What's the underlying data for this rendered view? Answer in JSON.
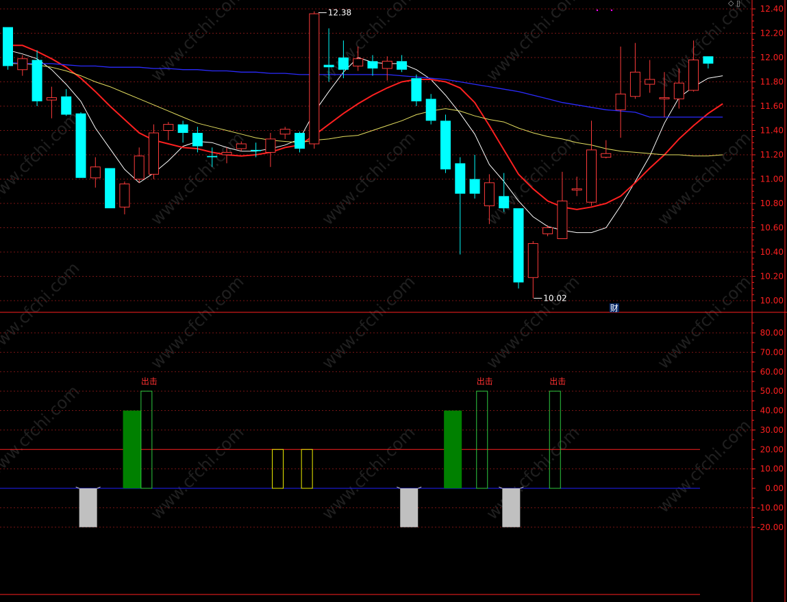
{
  "watermark": "www.cfchi.com",
  "colors": {
    "background": "#000000",
    "up": "#ff3b3b",
    "down": "#00ffff",
    "ma5": "#ffffff",
    "ma10": "#ff2020",
    "ma20": "#e6e060",
    "ma60": "#2b2bff",
    "axis": "#ff2020",
    "grid": "#7a1515",
    "green_bar": "#008000",
    "green_outline": "#2ecc40",
    "yellow_outline": "#f0f000",
    "gray_bar": "#c0c0c0",
    "signal_text": "#ff3030",
    "zero_line": "#2020ff"
  },
  "markers": {
    "high_label": "12.38",
    "low_label": "10.02",
    "cai_label": "财"
  },
  "chart_data": [
    {
      "type": "candlestick",
      "yaxis": {
        "ticks": [
          "12.40",
          "12.20",
          "12.00",
          "11.80",
          "11.60",
          "11.40",
          "11.20",
          "11.00",
          "10.80",
          "10.60",
          "10.40",
          "10.20",
          "10.00"
        ],
        "ylim": [
          9.93,
          12.46
        ]
      },
      "candles": [
        {
          "o": 12.25,
          "c": 11.93,
          "h": 12.25,
          "l": 11.9
        },
        {
          "o": 11.9,
          "c": 11.99,
          "h": 12.02,
          "l": 11.85
        },
        {
          "o": 11.98,
          "c": 11.64,
          "h": 12.06,
          "l": 11.6
        },
        {
          "o": 11.65,
          "c": 11.67,
          "h": 11.76,
          "l": 11.5
        },
        {
          "o": 11.68,
          "c": 11.53,
          "h": 11.74,
          "l": 11.52
        },
        {
          "o": 11.54,
          "c": 11.01,
          "h": 11.55,
          "l": 11.01
        },
        {
          "o": 11.01,
          "c": 11.1,
          "h": 11.18,
          "l": 10.93
        },
        {
          "o": 11.09,
          "c": 10.76,
          "h": 11.09,
          "l": 10.76
        },
        {
          "o": 10.77,
          "c": 10.96,
          "h": 10.98,
          "l": 10.71
        },
        {
          "o": 11.0,
          "c": 11.19,
          "h": 11.26,
          "l": 10.97
        },
        {
          "o": 11.04,
          "c": 11.38,
          "h": 11.45,
          "l": 11.0
        },
        {
          "o": 11.4,
          "c": 11.45,
          "h": 11.47,
          "l": 11.32
        },
        {
          "o": 11.45,
          "c": 11.38,
          "h": 11.48,
          "l": 11.3
        },
        {
          "o": 11.38,
          "c": 11.27,
          "h": 11.43,
          "l": 11.22
        },
        {
          "o": 11.19,
          "c": 11.18,
          "h": 11.26,
          "l": 11.1
        },
        {
          "o": 11.2,
          "c": 11.22,
          "h": 11.26,
          "l": 11.13
        },
        {
          "o": 11.25,
          "c": 11.29,
          "h": 11.31,
          "l": 11.23
        },
        {
          "o": 11.24,
          "c": 11.23,
          "h": 11.3,
          "l": 11.18
        },
        {
          "o": 11.22,
          "c": 11.33,
          "h": 11.38,
          "l": 11.1
        },
        {
          "o": 11.37,
          "c": 11.41,
          "h": 11.43,
          "l": 11.33
        },
        {
          "o": 11.38,
          "c": 11.25,
          "h": 11.39,
          "l": 11.22
        },
        {
          "o": 11.29,
          "c": 12.36,
          "h": 12.38,
          "l": 11.25
        },
        {
          "o": 11.94,
          "c": 11.92,
          "h": 12.24,
          "l": 11.8
        },
        {
          "o": 12.0,
          "c": 11.9,
          "h": 12.14,
          "l": 11.83
        },
        {
          "o": 11.93,
          "c": 11.99,
          "h": 12.09,
          "l": 11.89
        },
        {
          "o": 11.97,
          "c": 11.91,
          "h": 12.02,
          "l": 11.85
        },
        {
          "o": 11.91,
          "c": 11.97,
          "h": 12.01,
          "l": 11.81
        },
        {
          "o": 11.97,
          "c": 11.9,
          "h": 12.02,
          "l": 11.88
        },
        {
          "o": 11.83,
          "c": 11.64,
          "h": 11.86,
          "l": 11.6
        },
        {
          "o": 11.66,
          "c": 11.48,
          "h": 11.7,
          "l": 11.45
        },
        {
          "o": 11.48,
          "c": 11.08,
          "h": 11.53,
          "l": 11.05
        },
        {
          "o": 11.13,
          "c": 10.88,
          "h": 11.18,
          "l": 10.38
        },
        {
          "o": 11.0,
          "c": 10.88,
          "h": 11.2,
          "l": 10.84
        },
        {
          "o": 10.78,
          "c": 10.97,
          "h": 11.04,
          "l": 10.63
        },
        {
          "o": 10.86,
          "c": 10.76,
          "h": 11.05,
          "l": 10.73
        },
        {
          "o": 10.76,
          "c": 10.15,
          "h": 10.76,
          "l": 10.1
        },
        {
          "o": 10.19,
          "c": 10.47,
          "h": 10.49,
          "l": 10.02
        },
        {
          "o": 10.55,
          "c": 10.6,
          "h": 10.62,
          "l": 10.53
        },
        {
          "o": 10.51,
          "c": 10.82,
          "h": 11.06,
          "l": 10.51
        },
        {
          "o": 10.91,
          "c": 10.92,
          "h": 11.02,
          "l": 10.86
        },
        {
          "o": 10.81,
          "c": 11.24,
          "h": 11.48,
          "l": 10.78
        },
        {
          "o": 11.18,
          "c": 11.21,
          "h": 11.32,
          "l": 11.17
        },
        {
          "o": 11.57,
          "c": 11.7,
          "h": 12.09,
          "l": 11.34
        },
        {
          "o": 11.68,
          "c": 11.88,
          "h": 12.12,
          "l": 11.66
        },
        {
          "o": 11.78,
          "c": 11.82,
          "h": 11.98,
          "l": 11.71
        },
        {
          "o": 11.66,
          "c": 11.67,
          "h": 11.88,
          "l": 11.51
        },
        {
          "o": 11.66,
          "c": 11.79,
          "h": 11.91,
          "l": 11.58
        },
        {
          "o": 11.73,
          "c": 11.98,
          "h": 12.14,
          "l": 11.72
        },
        {
          "o": 12.01,
          "c": 11.95,
          "h": 12.01,
          "l": 11.91
        }
      ],
      "ma_series": [
        {
          "key": "ma5",
          "values": [
            12.06,
            12.03,
            11.99,
            11.9,
            11.78,
            11.64,
            11.42,
            11.25,
            11.08,
            10.97,
            11.05,
            11.15,
            11.27,
            11.31,
            11.3,
            11.26,
            11.23,
            11.23,
            11.25,
            11.28,
            11.33,
            11.55,
            11.72,
            11.88,
            12.0,
            11.96,
            11.95,
            11.95,
            11.9,
            11.82,
            11.69,
            11.54,
            11.37,
            11.12,
            10.98,
            10.82,
            10.69,
            10.61,
            10.58,
            10.56,
            10.56,
            10.6,
            10.78,
            10.98,
            11.19,
            11.46,
            11.67,
            11.76,
            11.83,
            11.85
          ]
        },
        {
          "key": "ma10",
          "values": [
            12.1,
            12.1,
            12.05,
            11.99,
            11.92,
            11.83,
            11.72,
            11.6,
            11.49,
            11.38,
            11.32,
            11.29,
            11.26,
            11.25,
            11.22,
            11.2,
            11.19,
            11.2,
            11.22,
            11.26,
            11.28,
            11.36,
            11.45,
            11.54,
            11.62,
            11.69,
            11.75,
            11.8,
            11.82,
            11.82,
            11.8,
            11.75,
            11.63,
            11.44,
            11.24,
            11.04,
            10.92,
            10.82,
            10.77,
            10.75,
            10.77,
            10.8,
            10.86,
            10.97,
            11.09,
            11.2,
            11.33,
            11.44,
            11.54,
            11.62
          ]
        },
        {
          "key": "ma20",
          "values": [
            11.95,
            11.95,
            11.94,
            11.92,
            11.89,
            11.85,
            11.8,
            11.76,
            11.71,
            11.66,
            11.61,
            11.56,
            11.51,
            11.46,
            11.43,
            11.4,
            11.37,
            11.34,
            11.32,
            11.31,
            11.3,
            11.32,
            11.33,
            11.35,
            11.36,
            11.4,
            11.44,
            11.48,
            11.53,
            11.56,
            11.58,
            11.56,
            11.52,
            11.49,
            11.47,
            11.42,
            11.38,
            11.35,
            11.33,
            11.3,
            11.28,
            11.25,
            11.23,
            11.22,
            11.21,
            11.2,
            11.2,
            11.19,
            11.19,
            11.2
          ]
        },
        {
          "key": "ma60",
          "values": [
            11.96,
            11.95,
            11.95,
            11.95,
            11.94,
            11.93,
            11.93,
            11.92,
            11.92,
            11.92,
            11.91,
            11.91,
            11.9,
            11.9,
            11.89,
            11.89,
            11.88,
            11.88,
            11.87,
            11.87,
            11.86,
            11.86,
            11.86,
            11.86,
            11.86,
            11.86,
            11.86,
            11.85,
            11.84,
            11.83,
            11.82,
            11.8,
            11.78,
            11.76,
            11.74,
            11.72,
            11.69,
            11.66,
            11.63,
            11.61,
            11.59,
            11.57,
            11.56,
            11.55,
            11.51,
            11.51,
            11.51,
            11.51,
            11.51,
            11.51
          ]
        }
      ]
    },
    {
      "type": "bar",
      "yaxis": {
        "ticks": [
          "80.00",
          "70.00",
          "60.00",
          "50.00",
          "40.00",
          "30.00",
          "20.00",
          "10.00",
          "0.00",
          "-10.00",
          "-20.00"
        ],
        "ylim": [
          -55,
          90
        ],
        "reference_line": 20,
        "zero_line": 0
      },
      "bars": [
        {
          "i": 5.5,
          "value": -20,
          "style": "gray"
        },
        {
          "i": 8.5,
          "value": 40,
          "style": "green-filled"
        },
        {
          "i": 9.5,
          "value": 50,
          "style": "green-outline",
          "label": "出击"
        },
        {
          "i": 18.5,
          "value": 20,
          "style": "yellow-outline"
        },
        {
          "i": 20.5,
          "value": 20,
          "style": "yellow-outline"
        },
        {
          "i": 27.5,
          "value": -20,
          "style": "gray"
        },
        {
          "i": 30.5,
          "value": 40,
          "style": "green-filled"
        },
        {
          "i": 32.5,
          "value": 50,
          "style": "green-outline",
          "label": "出击"
        },
        {
          "i": 34.5,
          "value": -20,
          "style": "gray"
        },
        {
          "i": 37.5,
          "value": 50,
          "style": "green-outline",
          "label": "出击"
        }
      ]
    }
  ]
}
